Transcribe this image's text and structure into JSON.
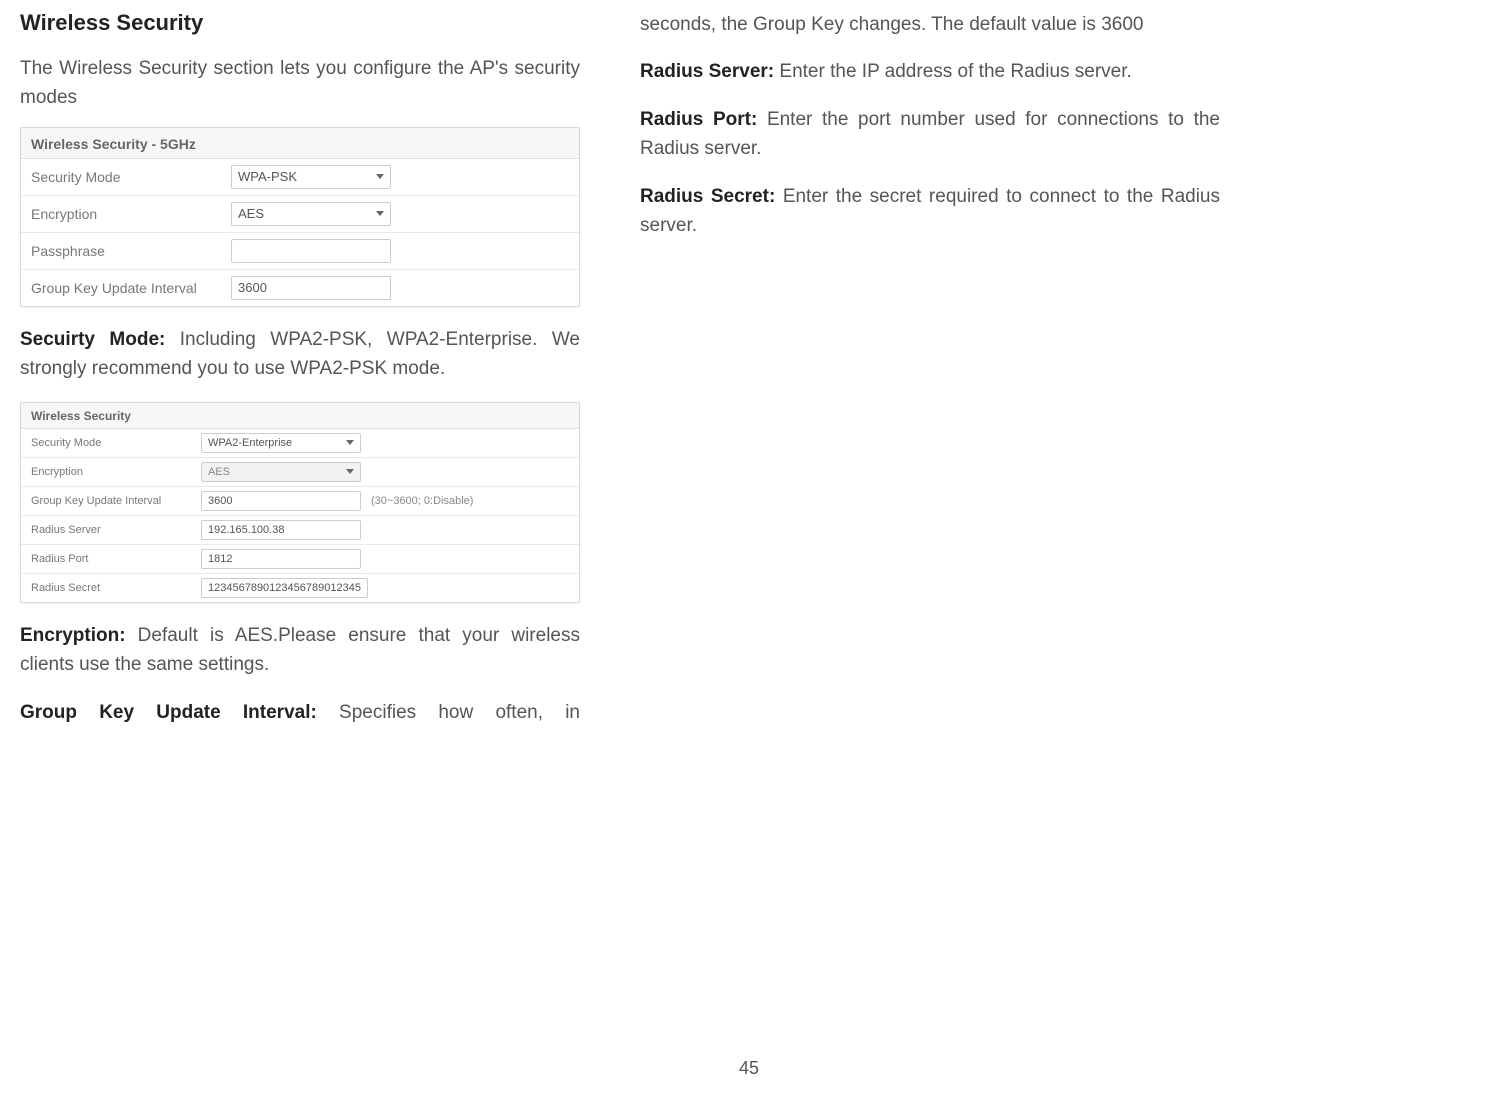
{
  "left": {
    "heading": "Wireless Security",
    "intro": "The Wireless Security section lets you configure the AP's security modes",
    "panel1": {
      "title": "Wireless Security - 5GHz",
      "rows": {
        "security_mode": {
          "label": "Security Mode",
          "value": "WPA-PSK"
        },
        "encryption": {
          "label": "Encryption",
          "value": "AES"
        },
        "passphrase": {
          "label": "Passphrase",
          "value": ""
        },
        "group_key": {
          "label": "Group Key Update Interval",
          "value": "3600"
        }
      }
    },
    "security_mode_desc": {
      "term": "Secuirty Mode: ",
      "text": "Including WPA2-PSK, WPA2-Enterprise. We strongly recommend you to use WPA2-PSK mode."
    },
    "panel2": {
      "title": "Wireless Security",
      "rows": {
        "security_mode": {
          "label": "Security Mode",
          "value": "WPA2-Enterprise"
        },
        "encryption": {
          "label": "Encryption",
          "value": "AES"
        },
        "group_key": {
          "label": "Group Key Update Interval",
          "value": "3600",
          "hint": "(30~3600; 0:Disable)"
        },
        "radius_server": {
          "label": "Radius Server",
          "value": "192.165.100.38"
        },
        "radius_port": {
          "label": "Radius Port",
          "value": "1812"
        },
        "radius_secret": {
          "label": "Radius Secret",
          "value": "1234567890123456789012345"
        }
      }
    },
    "encryption_desc": {
      "term": "Encryption: ",
      "text": "Default is AES.Please ensure that your wireless clients use the same settings."
    },
    "gkui_desc": {
      "term": "Group Key Update Interval: ",
      "text": "Specifies how often, in"
    }
  },
  "right": {
    "gkui_cont": "seconds, the Group Key changes. The default value is 3600",
    "radius_server_desc": {
      "term": "Radius Server: ",
      "text": "Enter the IP address of the Radius server."
    },
    "radius_port_desc": {
      "term": "Radius Port: ",
      "text": "Enter the port number used for connections to the Radius server."
    },
    "radius_secret_desc": {
      "term": "Radius Secret: ",
      "text": "Enter the secret required to connect to the Radius server."
    }
  },
  "page_number": "45"
}
